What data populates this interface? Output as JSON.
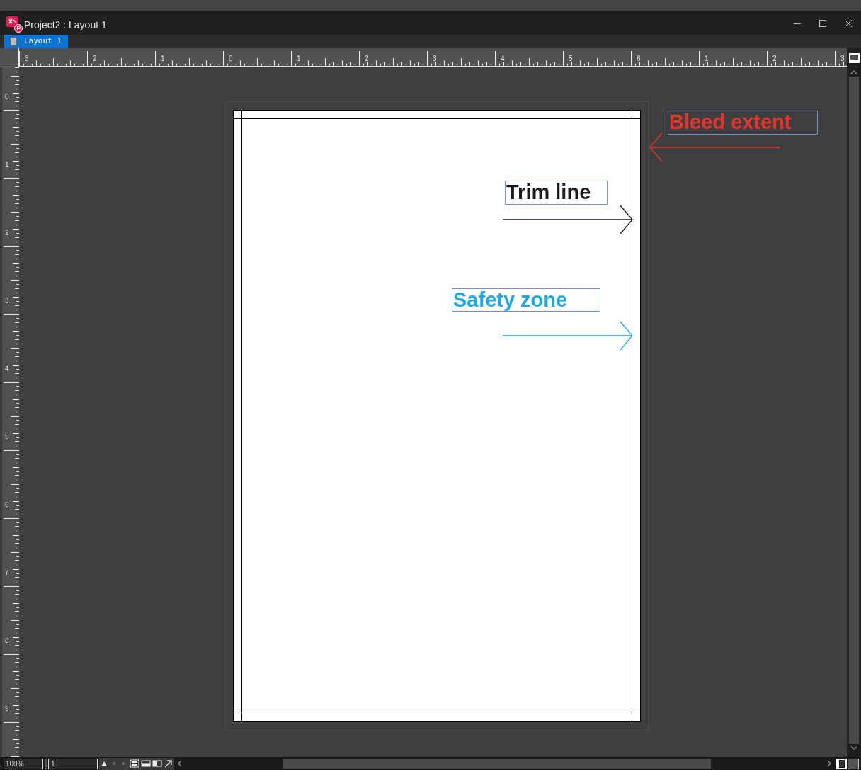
{
  "window": {
    "title": "Project2 : Layout 1"
  },
  "tabs": [
    {
      "label": "Layout 1",
      "selected": true
    }
  ],
  "top_ruler": {
    "labels": [
      "3",
      "2",
      "1",
      "0",
      "1",
      "2",
      "3",
      "4",
      "5",
      "6",
      "1",
      "2",
      "3"
    ]
  },
  "left_ruler": {
    "labels": [
      "0",
      "1",
      "2",
      "3",
      "4",
      "5",
      "6",
      "7",
      "8",
      "9"
    ]
  },
  "annotations": [
    {
      "text": "Bleed extent",
      "color": "#e8322e"
    },
    {
      "text": "Trim line",
      "color": "#1a1a1a"
    },
    {
      "text": "Safety zone",
      "color": "#1ca9e6"
    }
  ],
  "status_bar": {
    "zoom": "100%",
    "page": "1"
  }
}
